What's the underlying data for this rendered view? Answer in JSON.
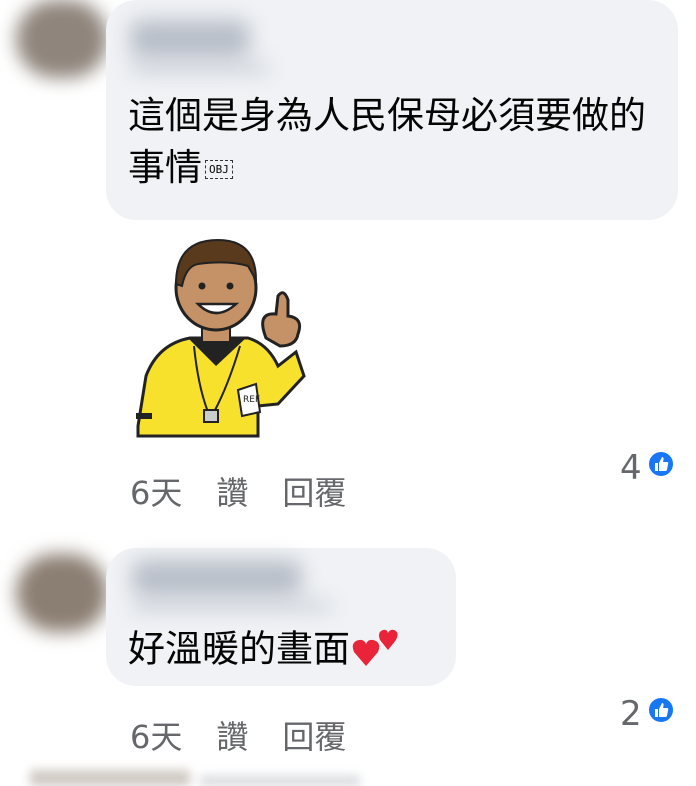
{
  "comments": [
    {
      "text": "這個是身為人民保母必須要做的事情",
      "obj_placeholder": "OBJ",
      "time": "6天",
      "like_label": "讚",
      "reply_label": "回覆",
      "reaction_count": "4",
      "sticker_label": "REF"
    },
    {
      "text": "好溫暖的畫面",
      "time": "6天",
      "like_label": "讚",
      "reply_label": "回覆",
      "reaction_count": "2",
      "emoji": "two-hearts"
    }
  ],
  "colors": {
    "bubble": "#f0f2f5",
    "meta_text": "#65676b",
    "like_blue": "#1877f2",
    "heart_red": "#e8233a"
  },
  "icons": [
    "avatar",
    "like-thumb-icon",
    "two-hearts-emoji",
    "referee-thumbs-up-sticker"
  ]
}
